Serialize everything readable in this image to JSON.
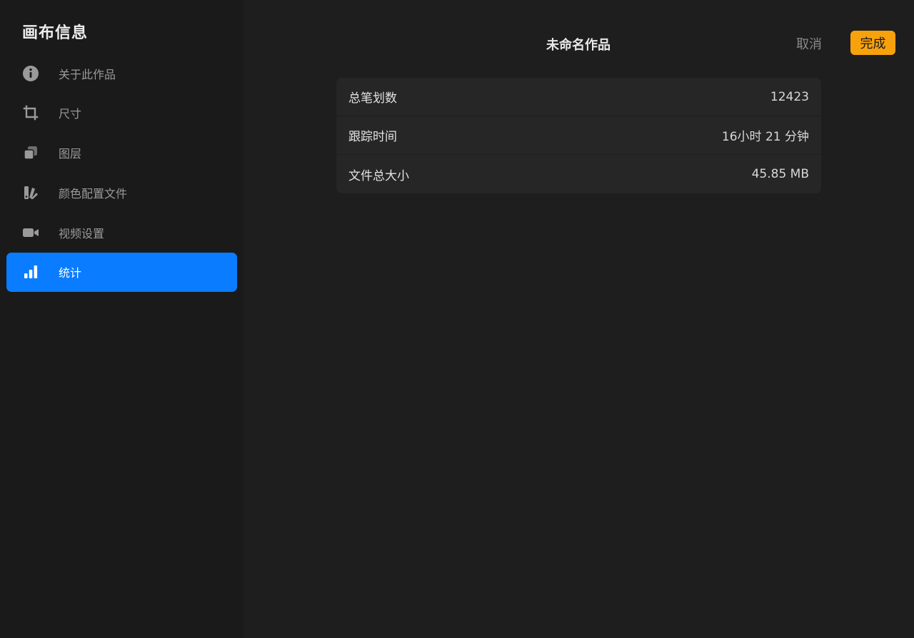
{
  "sidebar": {
    "title": "画布信息",
    "items": [
      {
        "label": "关于此作品",
        "icon": "info-icon",
        "active": false
      },
      {
        "label": "尺寸",
        "icon": "crop-icon",
        "active": false
      },
      {
        "label": "图层",
        "icon": "layers-icon",
        "active": false
      },
      {
        "label": "颜色配置文件",
        "icon": "color-profile-icon",
        "active": false
      },
      {
        "label": "视频设置",
        "icon": "video-camera-icon",
        "active": false
      },
      {
        "label": "统计",
        "icon": "bar-chart-icon",
        "active": true
      }
    ]
  },
  "header": {
    "title": "未命名作品",
    "cancel_label": "取消",
    "done_label": "完成"
  },
  "stats": {
    "rows": [
      {
        "label": "总笔划数",
        "value": "12423"
      },
      {
        "label": "跟踪时间",
        "value": "16小时 21 分钟"
      },
      {
        "label": "文件总大小",
        "value": "45.85 MB"
      }
    ]
  },
  "colors": {
    "accent": "#0a7cff",
    "done_button": "#f7a20c",
    "background": "#1e1e1e",
    "sidebar": "#1a1a1a",
    "card": "#262626"
  }
}
